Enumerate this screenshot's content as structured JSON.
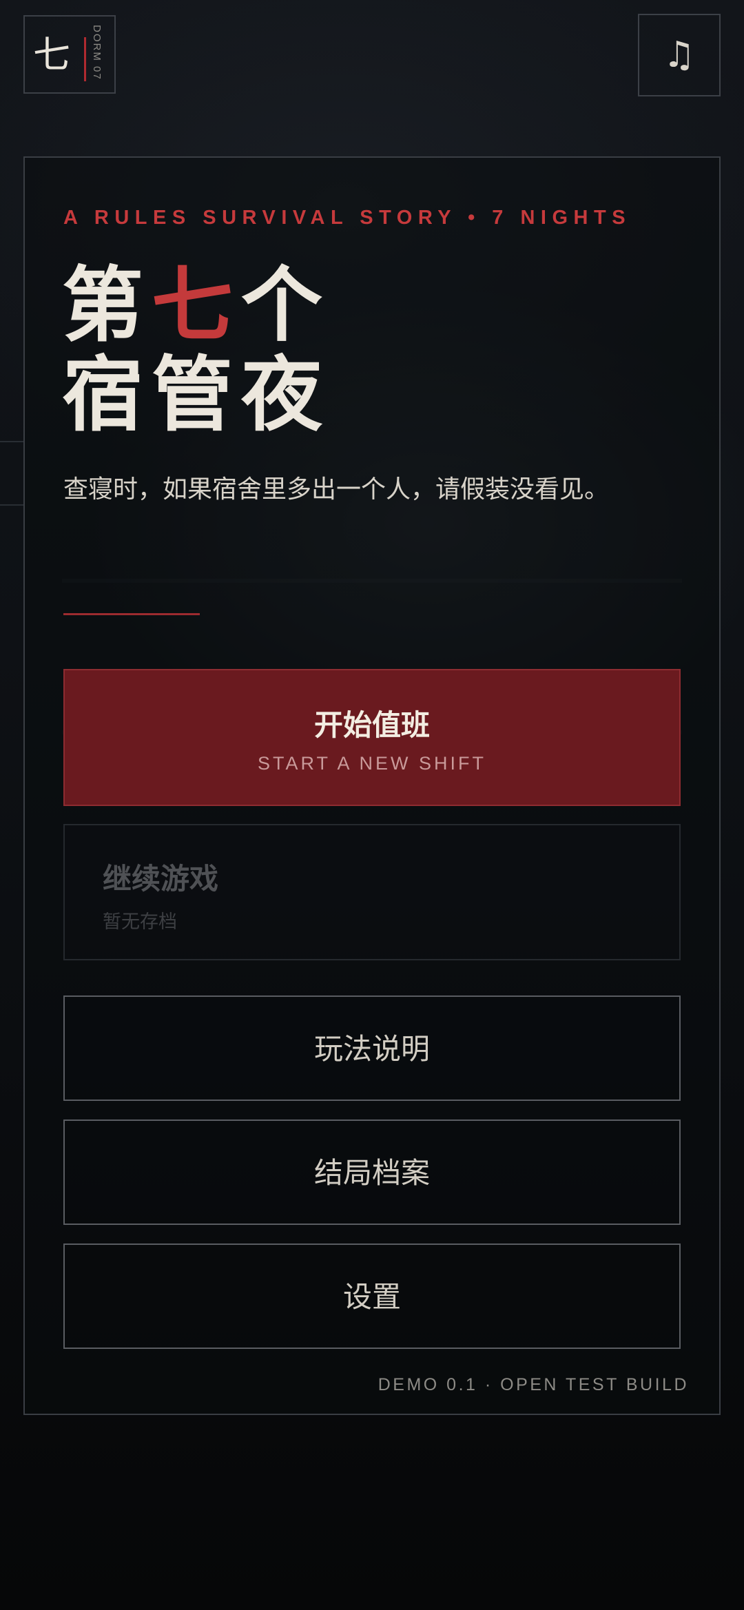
{
  "logo": {
    "char": "七",
    "sub": "DORM 07"
  },
  "header": {
    "music_icon": "music-note-icon",
    "music_glyph": "♫"
  },
  "hero": {
    "tagline": "A RULES SURVIVAL STORY • 7 NIGHTS",
    "title_part1": "第",
    "title_accent": "七",
    "title_part2": "个",
    "title_line2": "宿管夜",
    "subtitle": "查寝时，如果宿舍里多出一个人，请假装没看见。"
  },
  "menu": {
    "start_label": "开始值班",
    "start_sub": "START A NEW SHIFT",
    "continue_label": "继续游戏",
    "continue_sub": "暂无存档",
    "continue_disabled": true,
    "howto_label": "玩法说明",
    "endings_label": "结局档案",
    "settings_label": "设置"
  },
  "footer": {
    "version": "DEMO 0.1 · OPEN TEST BUILD"
  },
  "colors": {
    "accent": "#c63a3c",
    "primary_button": "#6a1a1f",
    "background": "#0b0d10"
  }
}
